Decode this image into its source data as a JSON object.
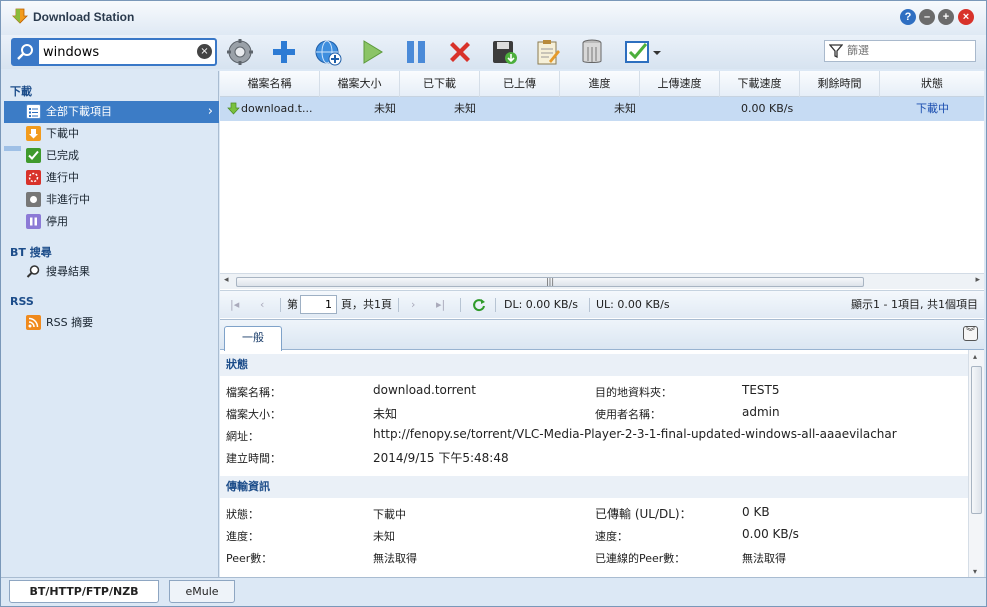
{
  "window": {
    "title": "Download Station"
  },
  "toolbar": {
    "search_value": "windows",
    "filter_placeholder": "篩選"
  },
  "sidebar": {
    "download_title": "下載",
    "items": [
      {
        "label": "全部下載項目"
      },
      {
        "label": "下載中"
      },
      {
        "label": "已完成"
      },
      {
        "label": "進行中"
      },
      {
        "label": "非進行中"
      },
      {
        "label": "停用"
      }
    ],
    "bt_title": "BT 搜尋",
    "bt_item": "搜尋結果",
    "rss_title": "RSS",
    "rss_item": "RSS 摘要"
  },
  "grid": {
    "columns": [
      "檔案名稱",
      "檔案大小",
      "已下載",
      "已上傳",
      "進度",
      "上傳速度",
      "下載速度",
      "剩餘時間",
      "狀態"
    ],
    "rows": [
      {
        "name": "download.t...",
        "size": "未知",
        "downloaded": "未知",
        "uploaded": "",
        "progress": "未知",
        "up_speed": "",
        "down_speed": "0.00 KB/s",
        "remaining": "",
        "status": "下載中"
      }
    ]
  },
  "pager": {
    "page_prefix": "第",
    "page_value": "1",
    "page_suffix": "頁，共1頁",
    "dl": "DL: 0.00 KB/s",
    "ul": "UL: 0.00 KB/s",
    "summary": "顯示1 - 1項目, 共1個項目"
  },
  "detail": {
    "tab_general": "一般",
    "status_section": "狀態",
    "fields": {
      "filename_label": "檔案名稱：",
      "filename": "download.torrent",
      "dest_label": "目的地資料夾：",
      "dest": "TEST5",
      "size_label": "檔案大小：",
      "size": "未知",
      "user_label": "使用者名稱：",
      "user": "admin",
      "url_label": "網址：",
      "url": "http://fenopy.se/torrent/VLC-Media-Player-2-3-1-final-updated-windows-all-aaaevilachar",
      "created_label": "建立時間：",
      "created": "2014/9/15 下午5:48:48"
    },
    "transfer_section": "傳輸資訊",
    "transfer": {
      "status_label": "狀態：",
      "status": "下載中",
      "transferred_label": "已傳輸 (UL/DL)：",
      "transferred": "0 KB",
      "progress_label": "進度：",
      "progress": "未知",
      "speed_label": "速度：",
      "speed": "0.00 KB/s",
      "peers_label": "Peer數：",
      "peers": "無法取得",
      "connected_peers_label": "已連線的Peer數：",
      "connected_peers": "無法取得"
    }
  },
  "bottom_tabs": [
    "BT/HTTP/FTP/NZB",
    "eMule"
  ]
}
